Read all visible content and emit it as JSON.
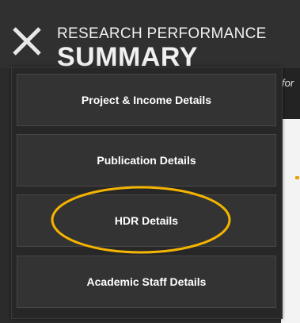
{
  "header": {
    "title_line1": "RESEARCH PERFORMANCE",
    "title_line2": "SUMMARY",
    "close_icon": "close-icon"
  },
  "background": {
    "right_snippet": "for"
  },
  "menu": {
    "items": [
      {
        "label": "Project & Income Details"
      },
      {
        "label": "Publication Details"
      },
      {
        "label": "HDR Details"
      },
      {
        "label": "Academic Staff Details"
      }
    ]
  },
  "annotation": {
    "highlighted_item": "HDR Details",
    "color": "#f4b400"
  },
  "colors": {
    "backdrop": "#2b2b2b",
    "menu_item_bg": "#333333",
    "menu_item_border": "#474747",
    "text": "#ffffff",
    "accent": "#f4b400"
  }
}
